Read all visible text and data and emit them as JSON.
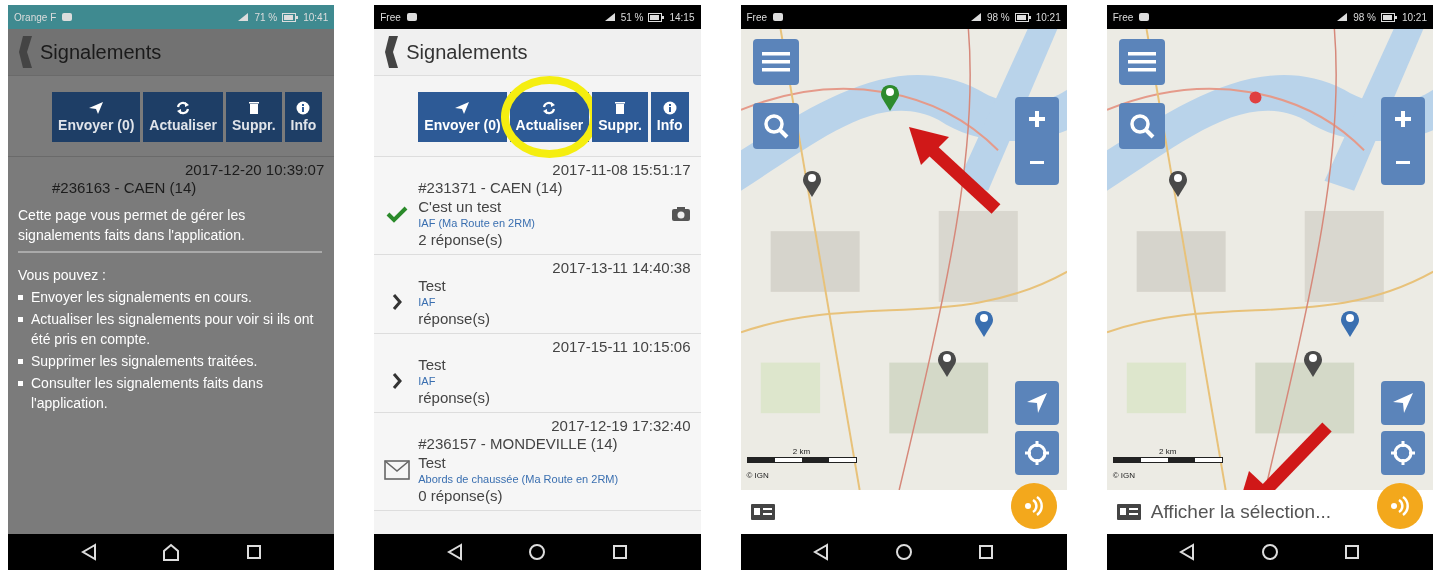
{
  "phones": [
    {
      "kind": "list",
      "status_bar": {
        "carrier": "Orange F",
        "battery": "71 %",
        "time": "10:41"
      },
      "header": {
        "title": "Signalements"
      },
      "toolbar": [
        {
          "label": "Envoyer (0)",
          "highlighted": false
        },
        {
          "label": "Actualiser",
          "highlighted": false
        },
        {
          "label": "Suppr.",
          "highlighted": false
        },
        {
          "label": "Info",
          "highlighted": false
        }
      ],
      "reports": [
        {
          "date": "2017-12-20 10:39:07",
          "title": "#236163 - CAEN (14)"
        }
      ],
      "help": {
        "intro": "Cette page vous permet de gérer les signalements faits dans l'application.",
        "lead": "Vous pouvez :",
        "items": [
          "Envoyer les signalements en cours.",
          "Actualiser les signalements pour voir si ils ont été pris en compte.",
          "Supprimer les signalements traitées.",
          "Consulter les signalements faits dans l'application."
        ]
      }
    },
    {
      "kind": "list",
      "status_bar": {
        "carrier": "Free",
        "battery": "51 %",
        "time": "14:15"
      },
      "header": {
        "title": "Signalements"
      },
      "toolbar": [
        {
          "label": "Envoyer (0)",
          "highlighted": false
        },
        {
          "label": "Actualiser",
          "highlighted": true
        },
        {
          "label": "Suppr.",
          "highlighted": false
        },
        {
          "label": "Info",
          "highlighted": false
        }
      ],
      "reports": [
        {
          "date": "2017-11-08 15:51:17",
          "title": "#231371 - CAEN (14)",
          "text": "C'est un test",
          "category": "IAF (Ma Route en 2RM)",
          "replies": "2 réponse(s)",
          "kind": "resolved",
          "photo": true
        },
        {
          "date": "2017-13-11 14:40:38",
          "text": "Test",
          "category": "IAF",
          "replies": "réponse(s)",
          "kind": "pending",
          "photo": false
        },
        {
          "date": "2017-15-11 10:15:06",
          "text": "Test",
          "category": "IAF",
          "replies": "réponse(s)",
          "kind": "pending",
          "photo": false
        },
        {
          "date": "2017-12-19 17:32:40",
          "title": "#236157 - MONDEVILLE (14)",
          "text": "Test",
          "category": "Abords de chaussée (Ma Route en 2RM)",
          "replies": "0 réponse(s)",
          "kind": "sent",
          "photo": false
        }
      ]
    },
    {
      "kind": "map",
      "status_bar": {
        "carrier": "Free",
        "battery": "98 %",
        "time": "10:21"
      },
      "markers": [
        {
          "kind": "pin",
          "color": "#2e8b2e"
        },
        {
          "kind": "pin",
          "color": "#4a4a4a"
        },
        {
          "kind": "pin",
          "color": "#3a6fb0"
        },
        {
          "kind": "pin",
          "color": "#4a4a4a"
        }
      ],
      "scale": "2 km",
      "credit": "© IGN",
      "annotation": {
        "kind": "marker"
      }
    },
    {
      "kind": "map",
      "status_bar": {
        "carrier": "Free",
        "battery": "98 %",
        "time": "10:21"
      },
      "markers": [
        {
          "kind": "dot",
          "color": "#e04040"
        },
        {
          "kind": "pin",
          "color": "#4a4a4a"
        },
        {
          "kind": "pin",
          "color": "#3a6fb0"
        },
        {
          "kind": "pin",
          "color": "#4a4a4a"
        }
      ],
      "scale": "2 km",
      "credit": "© IGN",
      "annotation": {
        "kind": "selection"
      },
      "selection_label": "Afficher la sélection..."
    }
  ]
}
